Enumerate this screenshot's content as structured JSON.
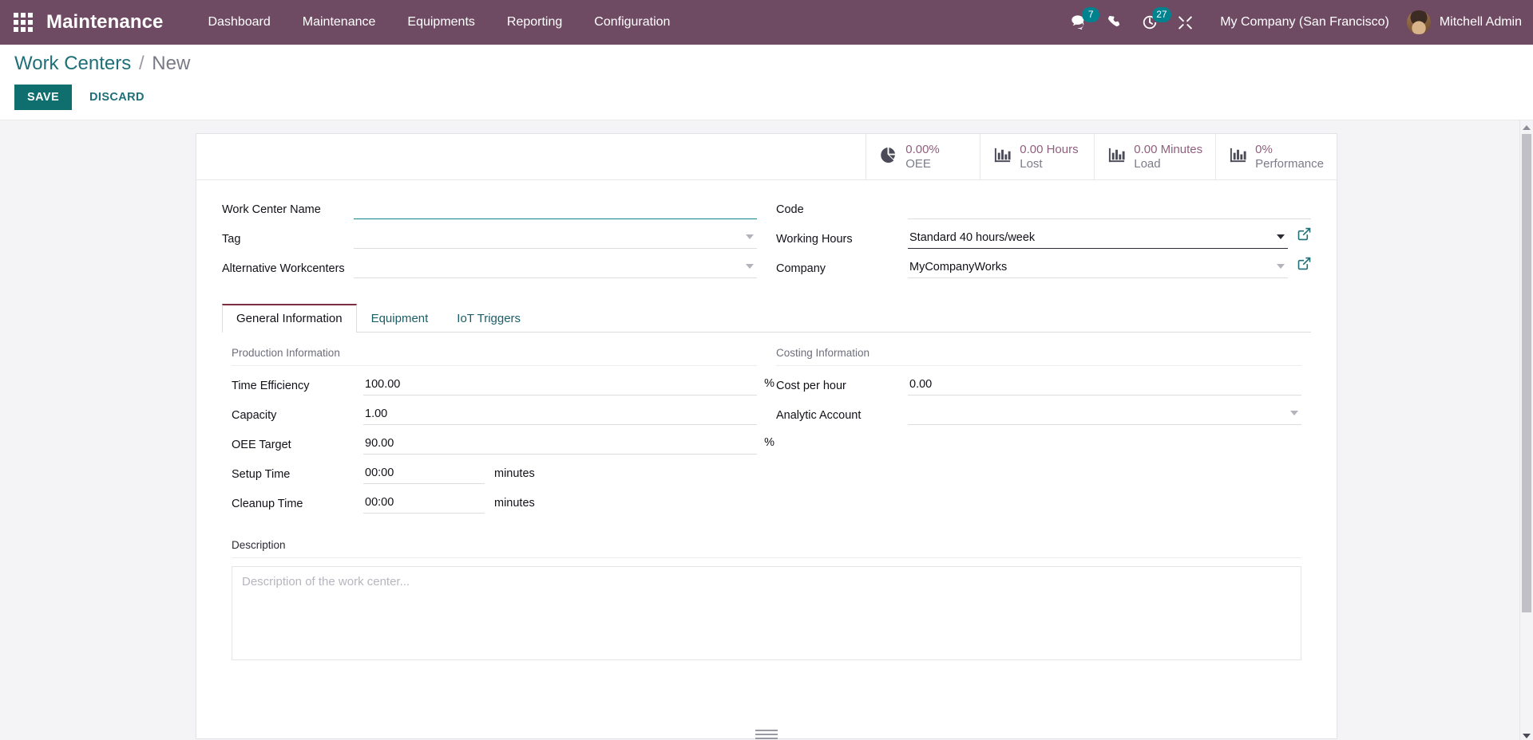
{
  "navbar": {
    "apps_icon": "apps-grid-icon",
    "brand": "Maintenance",
    "menu": [
      {
        "label": "Dashboard"
      },
      {
        "label": "Maintenance"
      },
      {
        "label": "Equipments"
      },
      {
        "label": "Reporting"
      },
      {
        "label": "Configuration"
      }
    ],
    "messages_icon": "messages-icon",
    "messages_badge": "7",
    "phone_icon": "phone-icon",
    "activities_icon": "activity-clock-icon",
    "activities_badge": "27",
    "tools_icon": "tools-icon",
    "company": "My Company (San Francisco)",
    "user": "Mitchell Admin",
    "accent_color": "#6f4b63",
    "badge_color": "#00838f"
  },
  "control_panel": {
    "breadcrumb_root": "Work Centers",
    "breadcrumb_sep": "/",
    "breadcrumb_current": "New",
    "save_label": "SAVE",
    "discard_label": "DISCARD",
    "save_color": "#0f6e6e",
    "link_color": "#1f6f78"
  },
  "stats": [
    {
      "icon": "pie-chart-icon",
      "value": "0.00%",
      "label": "OEE"
    },
    {
      "icon": "bar-chart-icon",
      "value": "0.00 Hours",
      "label": "Lost"
    },
    {
      "icon": "bar-chart-icon",
      "value": "0.00 Minutes",
      "label": "Load"
    },
    {
      "icon": "bar-chart-icon",
      "value": "0%",
      "label": "Performance"
    }
  ],
  "form": {
    "left": [
      {
        "label": "Work Center Name",
        "value": "",
        "placeholder": "",
        "type": "text",
        "focused": true
      },
      {
        "label": "Tag",
        "value": "",
        "placeholder": "",
        "type": "select"
      },
      {
        "label": "Alternative Workcenters",
        "value": "",
        "placeholder": "",
        "type": "select"
      }
    ],
    "right": [
      {
        "label": "Code",
        "value": "",
        "placeholder": "",
        "type": "text"
      },
      {
        "label": "Working Hours",
        "value": "Standard 40 hours/week",
        "placeholder": "",
        "type": "select",
        "external_link": true,
        "strong": true
      },
      {
        "label": "Company",
        "value": "MyCompanyWorks",
        "placeholder": "",
        "type": "select",
        "external_link": true
      }
    ]
  },
  "tabs": [
    {
      "label": "General Information",
      "active": true
    },
    {
      "label": "Equipment",
      "active": false
    },
    {
      "label": "IoT Triggers",
      "active": false
    }
  ],
  "production": {
    "title": "Production Information",
    "fields": [
      {
        "label": "Time Efficiency",
        "value": "100.00",
        "suffix": "%"
      },
      {
        "label": "Capacity",
        "value": "1.00",
        "suffix": ""
      },
      {
        "label": "OEE Target",
        "value": "90.00",
        "suffix": "%"
      },
      {
        "label": "Setup Time",
        "value": "00:00",
        "suffix": "minutes",
        "short": true
      },
      {
        "label": "Cleanup Time",
        "value": "00:00",
        "suffix": "minutes",
        "short": true
      }
    ]
  },
  "costing": {
    "title": "Costing Information",
    "fields": [
      {
        "label": "Cost per hour",
        "value": "0.00",
        "suffix": ""
      },
      {
        "label": "Analytic Account",
        "value": "",
        "suffix": "",
        "type": "select"
      }
    ]
  },
  "description": {
    "title": "Description",
    "placeholder": "Description of the work center..."
  }
}
